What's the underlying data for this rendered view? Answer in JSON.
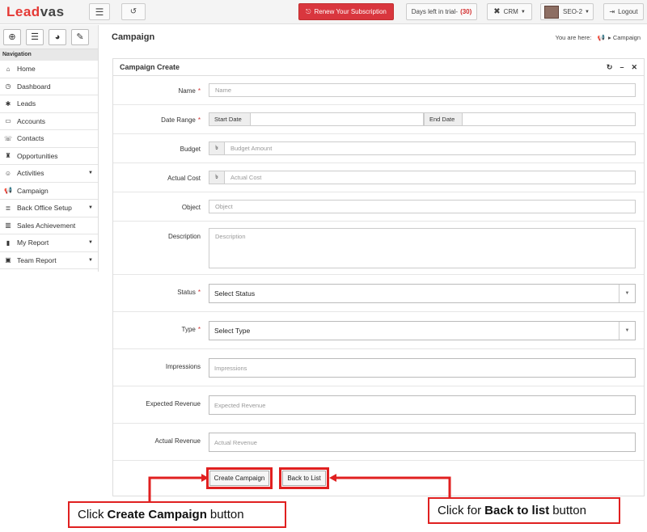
{
  "topbar": {
    "logo_part1": "Lead",
    "logo_part2": "vas",
    "renew_label": "Renew Your Subscription",
    "days_label": "Days left in trial-",
    "days_value": "(30)",
    "crm_label": "CRM",
    "user_label": "SEO-2",
    "logout_label": "Logout"
  },
  "sidebar": {
    "nav_title": "Navigation",
    "items": [
      {
        "label": "Home",
        "icon": "home-icon",
        "glyph": "⌂",
        "has_caret": false
      },
      {
        "label": "Dashboard",
        "icon": "dashboard-icon",
        "glyph": "◷",
        "has_caret": false
      },
      {
        "label": "Leads",
        "icon": "leads-icon",
        "glyph": "✱",
        "has_caret": false
      },
      {
        "label": "Accounts",
        "icon": "accounts-icon",
        "glyph": "▭",
        "has_caret": false
      },
      {
        "label": "Contacts",
        "icon": "phone-icon",
        "glyph": "☏",
        "has_caret": false
      },
      {
        "label": "Opportunities",
        "icon": "opportunities-icon",
        "glyph": "♜",
        "has_caret": false
      },
      {
        "label": "Activities",
        "icon": "activities-icon",
        "glyph": "☺",
        "has_caret": true
      },
      {
        "label": "Campaign",
        "icon": "megaphone-icon",
        "glyph": "📢",
        "has_caret": false
      },
      {
        "label": "Back Office Setup",
        "icon": "settings-icon",
        "glyph": "≣",
        "has_caret": true
      },
      {
        "label": "Sales Achievement",
        "icon": "achievement-icon",
        "glyph": "▥",
        "has_caret": false
      },
      {
        "label": "My Report",
        "icon": "report-icon",
        "glyph": "▮",
        "has_caret": true
      },
      {
        "label": "Team Report",
        "icon": "team-report-icon",
        "glyph": "▣",
        "has_caret": true
      }
    ]
  },
  "page": {
    "title": "Campaign",
    "breadcrumb_prefix": "You are here:",
    "breadcrumb_current": "Campaign"
  },
  "form": {
    "panel_title": "Campaign Create",
    "name_label": "Name",
    "name_placeholder": "Name",
    "date_label": "Date Range",
    "start_date": "Start Date",
    "end_date": "End Date",
    "budget_label": "Budget",
    "budget_placeholder": "Budget Amount",
    "actual_cost_label": "Actual Cost",
    "actual_cost_placeholder": "Actual Cost",
    "object_label": "Object",
    "object_placeholder": "Object",
    "description_label": "Description",
    "description_placeholder": "Description",
    "status_label": "Status",
    "status_value": "Select Status",
    "type_label": "Type",
    "type_value": "Select Type",
    "impressions_label": "Impressions",
    "impressions_placeholder": "Impressions",
    "expected_revenue_label": "Expected Revenue",
    "expected_revenue_placeholder": "Expected Revenue",
    "actual_revenue_label": "Actual Revenue",
    "actual_revenue_placeholder": "Actual Revenue",
    "create_button": "Create Campaign",
    "back_button": "Back to List",
    "currency_symbol": "৳"
  },
  "annotations": {
    "left_prefix": "Click",
    "left_bold": "Create Campaign",
    "left_suffix": "button",
    "right_prefix": "Click for",
    "right_bold": "Back to list",
    "right_suffix": "button",
    "color": "#e02020"
  }
}
